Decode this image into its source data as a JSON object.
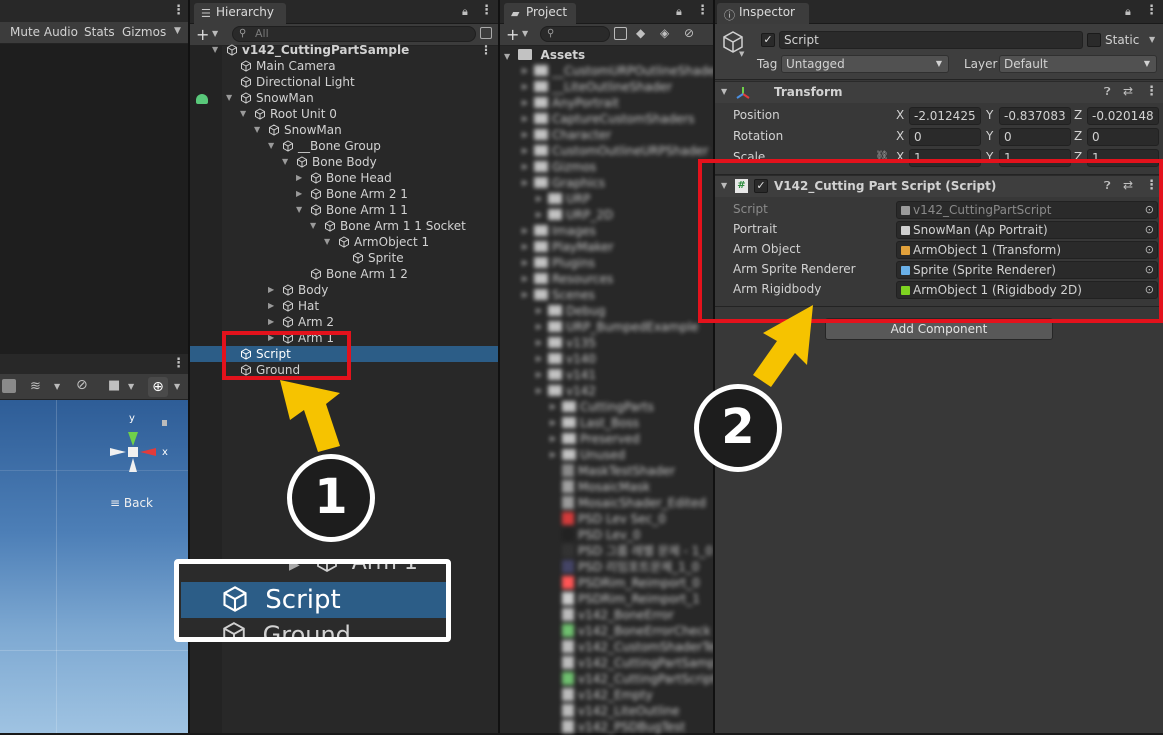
{
  "scene_toolbar": {
    "mute_audio": "Mute Audio",
    "stats": "Stats",
    "gizmos": "Gizmos"
  },
  "hierarchy": {
    "tab": "Hierarchy",
    "search_placeholder": "All",
    "items": [
      {
        "label": "v142_CuttingPartSample",
        "depth": 0,
        "arrow": "down"
      },
      {
        "label": "Main Camera",
        "depth": 1,
        "arrow": ""
      },
      {
        "label": "Directional Light",
        "depth": 1,
        "arrow": ""
      },
      {
        "label": "SnowMan",
        "depth": 1,
        "arrow": "down"
      },
      {
        "label": "Root Unit 0",
        "depth": 2,
        "arrow": "down"
      },
      {
        "label": "SnowMan",
        "depth": 3,
        "arrow": "down"
      },
      {
        "label": "__Bone Group",
        "depth": 4,
        "arrow": "down"
      },
      {
        "label": "Bone Body",
        "depth": 5,
        "arrow": "down"
      },
      {
        "label": "Bone Head",
        "depth": 6,
        "arrow": "right"
      },
      {
        "label": "Bone Arm 2 1",
        "depth": 6,
        "arrow": "right"
      },
      {
        "label": "Bone Arm 1 1",
        "depth": 6,
        "arrow": "down"
      },
      {
        "label": "Bone Arm 1 1 Socket",
        "depth": 7,
        "arrow": "down"
      },
      {
        "label": "ArmObject 1",
        "depth": 8,
        "arrow": "down"
      },
      {
        "label": "Sprite",
        "depth": 9,
        "arrow": ""
      },
      {
        "label": "Bone Arm 1 2",
        "depth": 6,
        "arrow": ""
      },
      {
        "label": "Body",
        "depth": 4,
        "arrow": "right"
      },
      {
        "label": "Hat",
        "depth": 4,
        "arrow": "right"
      },
      {
        "label": "Arm 2",
        "depth": 4,
        "arrow": "right"
      },
      {
        "label": "Arm 1",
        "depth": 4,
        "arrow": "right"
      },
      {
        "label": "Script",
        "depth": 1,
        "arrow": "",
        "selected": true
      },
      {
        "label": "Ground",
        "depth": 1,
        "arrow": ""
      }
    ]
  },
  "project": {
    "tab": "Project",
    "root": "Assets",
    "items": [
      {
        "label": "__CustomURPOutlineShader",
        "depth": 1,
        "kind": "folder"
      },
      {
        "label": "__LiteOutlineShader",
        "depth": 1,
        "kind": "folder"
      },
      {
        "label": "AnyPortrait",
        "depth": 1,
        "kind": "folder"
      },
      {
        "label": "CaptureCustomShaders",
        "depth": 1,
        "kind": "folder"
      },
      {
        "label": "Character",
        "depth": 1,
        "kind": "folder"
      },
      {
        "label": "CustomOutlineURPShader",
        "depth": 1,
        "kind": "folder"
      },
      {
        "label": "Gizmos",
        "depth": 1,
        "kind": "folder"
      },
      {
        "label": "Graphics",
        "depth": 1,
        "kind": "folder"
      },
      {
        "label": "URP",
        "depth": 2,
        "kind": "folder"
      },
      {
        "label": "URP_2D",
        "depth": 2,
        "kind": "folder"
      },
      {
        "label": "Images",
        "depth": 1,
        "kind": "folder"
      },
      {
        "label": "PlayMaker",
        "depth": 1,
        "kind": "folder"
      },
      {
        "label": "Plugins",
        "depth": 1,
        "kind": "folder"
      },
      {
        "label": "Resources",
        "depth": 1,
        "kind": "folder"
      },
      {
        "label": "Scenes",
        "depth": 1,
        "kind": "folder"
      },
      {
        "label": "Debug",
        "depth": 2,
        "kind": "folder"
      },
      {
        "label": "URP_BumpedExample",
        "depth": 2,
        "kind": "folder"
      },
      {
        "label": "v135",
        "depth": 2,
        "kind": "folder"
      },
      {
        "label": "v140",
        "depth": 2,
        "kind": "folder"
      },
      {
        "label": "v141",
        "depth": 2,
        "kind": "folder"
      },
      {
        "label": "v142",
        "depth": 2,
        "kind": "folder"
      },
      {
        "label": "CuttingParts",
        "depth": 3,
        "kind": "folder"
      },
      {
        "label": "Last_Boss",
        "depth": 3,
        "kind": "folder"
      },
      {
        "label": "Preserved",
        "depth": 3,
        "kind": "folder"
      },
      {
        "label": "Unused",
        "depth": 3,
        "kind": "folder"
      },
      {
        "label": "MaskTestShader",
        "depth": 3,
        "kind": "file",
        "color": "#8a8a8a"
      },
      {
        "label": "MosaicMask",
        "depth": 3,
        "kind": "file",
        "color": "#a0a0a0"
      },
      {
        "label": "MosaicShader_Edited",
        "depth": 3,
        "kind": "file",
        "color": "#9a9a9a"
      },
      {
        "label": "PSD Lev Sec_0",
        "depth": 3,
        "kind": "file",
        "color": "#d23a3a"
      },
      {
        "label": "PSD Lev_0",
        "depth": 3,
        "kind": "file",
        "color": "#222222"
      },
      {
        "label": "PSD 그룹 레벨 문제 - 1_0",
        "depth": 3,
        "kind": "file",
        "color": "#333333"
      },
      {
        "label": "PSD 리임포트문제_1_0",
        "depth": 3,
        "kind": "file",
        "color": "#444466"
      },
      {
        "label": "PSDRim_Reimport_0",
        "depth": 3,
        "kind": "file",
        "color": "#ff5555"
      },
      {
        "label": "PSDRim_Reimport_1",
        "depth": 3,
        "kind": "file",
        "color": "#cccccc"
      },
      {
        "label": "v142_BoneError",
        "depth": 3,
        "kind": "file",
        "color": "#bbbbbb"
      },
      {
        "label": "v142_BoneErrorCheck",
        "depth": 3,
        "kind": "file",
        "color": "#6fbf6f"
      },
      {
        "label": "v142_CustomShaderTest",
        "depth": 3,
        "kind": "file",
        "color": "#bbbbbb"
      },
      {
        "label": "v142_CuttingPartSample",
        "depth": 3,
        "kind": "file",
        "color": "#bbbbbb"
      },
      {
        "label": "v142_CuttingPartScript",
        "depth": 3,
        "kind": "file",
        "color": "#6fbf6f"
      },
      {
        "label": "v142_Empty",
        "depth": 3,
        "kind": "file",
        "color": "#bbbbbb"
      },
      {
        "label": "v142_LiteOutline",
        "depth": 3,
        "kind": "file",
        "color": "#bbbbbb"
      },
      {
        "label": "v142_PSDBugTest",
        "depth": 3,
        "kind": "file",
        "color": "#bbbbbb"
      }
    ]
  },
  "inspector": {
    "tab": "Inspector",
    "object_name": "Script",
    "static_label": "Static",
    "tag_label": "Tag",
    "tag_value": "Untagged",
    "layer_label": "Layer",
    "layer_value": "Default",
    "transform": {
      "title": "Transform",
      "position_label": "Position",
      "rotation_label": "Rotation",
      "scale_label": "Scale",
      "x": "X",
      "y": "Y",
      "z": "Z",
      "position": [
        "-2.012425",
        "-0.837083",
        "-0.020148"
      ],
      "rotation": [
        "0",
        "0",
        "0"
      ],
      "scale": [
        "1",
        "1",
        "1"
      ]
    },
    "component": {
      "title": "V142_Cutting Part Script (Script)",
      "rows": [
        {
          "label": "Script",
          "value": "v142_CuttingPartScript",
          "disabled": true
        },
        {
          "label": "Portrait",
          "value": "SnowMan (Ap Portrait)"
        },
        {
          "label": "Arm Object",
          "value": "ArmObject 1 (Transform)"
        },
        {
          "label": "Arm Sprite Renderer",
          "value": "Sprite (Sprite Renderer)"
        },
        {
          "label": "Arm Rigidbody",
          "value": "ArmObject 1 (Rigidbody 2D)"
        }
      ]
    },
    "add_component": "Add Component"
  },
  "scene_view": {
    "back_label": "Back",
    "axis_y": "y",
    "axis_x": "x"
  },
  "callouts": {
    "one": "1",
    "two": "2",
    "zoom_rows": [
      "Arm 1",
      "Script",
      "Ground"
    ]
  },
  "colors": {
    "selection": "#2c5d87",
    "highlight": "#e3121c",
    "arrow": "#f6c300",
    "sky_top": "#2e5d97",
    "sky_bottom": "#9fc3e2"
  }
}
